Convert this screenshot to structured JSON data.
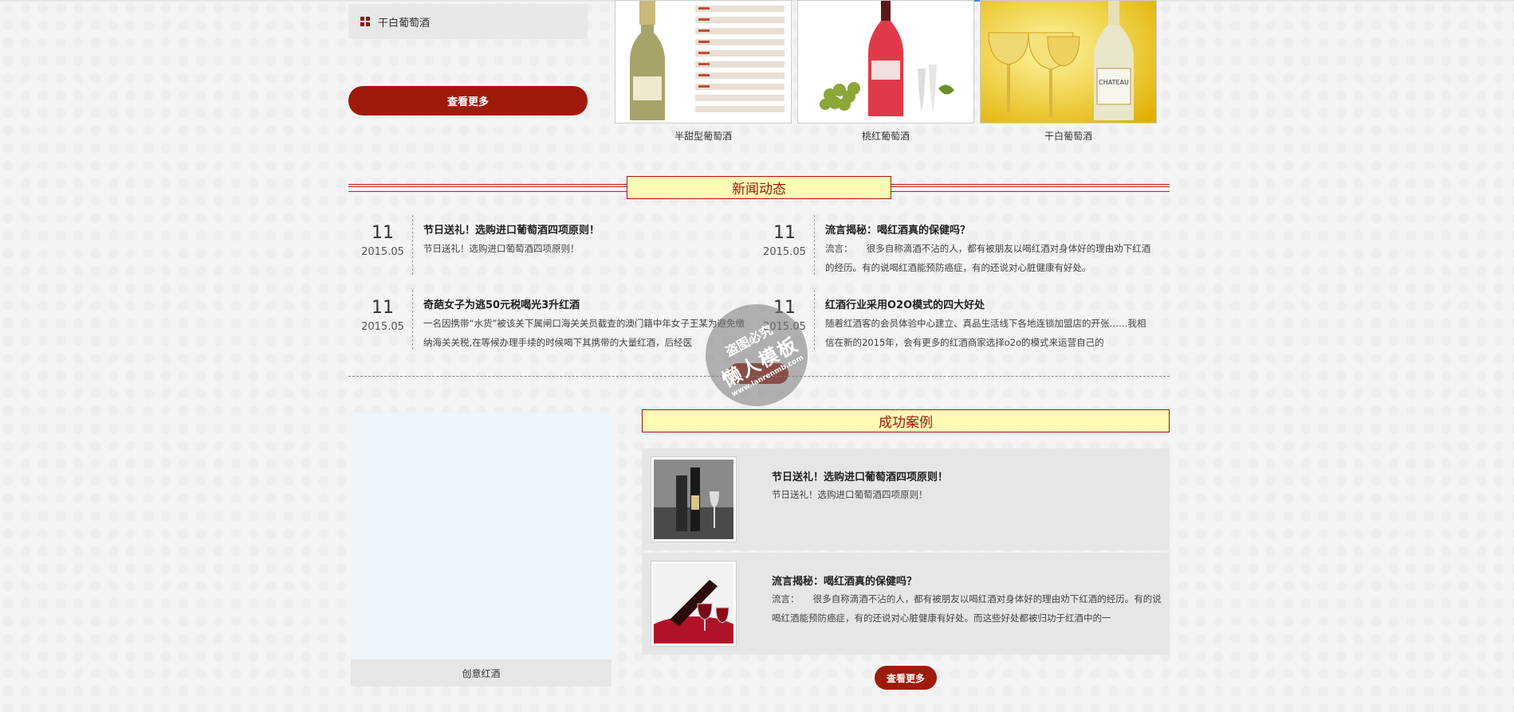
{
  "sidebar": {
    "category_label": "干白葡萄酒",
    "more_button": "查看更多"
  },
  "products": [
    {
      "caption": "半甜型葡萄酒"
    },
    {
      "caption": "桃红葡萄酒"
    },
    {
      "caption": "干白葡萄酒"
    }
  ],
  "news": {
    "title": "新闻动态",
    "items": [
      {
        "day": "11",
        "ym": "2015.05",
        "title": "节日送礼！选购进口葡萄酒四项原则！",
        "desc": "节日送礼！选购进口葡萄酒四项原则！"
      },
      {
        "day": "11",
        "ym": "2015.05",
        "title": "流言揭秘：喝红酒真的保健吗？",
        "desc": "流言：　　很多自称滴酒不沾的人，都有被朋友以喝红酒对身体好的理由劝下红酒的经历。有的说喝红酒能预防癌症，有的还说对心脏健康有好处。"
      },
      {
        "day": "11",
        "ym": "2015.05",
        "title": "奇葩女子为逃50元税喝光3升红酒",
        "desc": "一名因携带“水货”被该关下属闸口海关关员截查的澳门籍中年女子王某为避免缴纳海关关税,在等候办理手续的时候喝下其携带的大量红酒，后经医"
      },
      {
        "day": "11",
        "ym": "2015.05",
        "title": "红酒行业采用O2O模式的四大好处",
        "desc": "随着红酒客的会员体验中心建立、真品生活线下各地连锁加盟店的开张……我相信在新的2015年，会有更多的红酒商家选择o2o的模式来运营自己的"
      }
    ]
  },
  "watermark": {
    "line1": "盗图必究",
    "line2": "懒人模板",
    "line3": "www.lanrenmb.com"
  },
  "creative": {
    "caption": "创意红酒"
  },
  "cases": {
    "title": "成功案例",
    "items": [
      {
        "title": "节日送礼！选购进口葡萄酒四项原则！",
        "desc": "节日送礼！选购进口葡萄酒四项原则！"
      },
      {
        "title": "流言揭秘：喝红酒真的保健吗？",
        "desc": "流言：　　很多自称滴酒不沾的人，都有被朋友以喝红酒对身体好的理由劝下红酒的经历。有的说喝红酒能预防癌症，有的还说对心脏健康有好处。而这些好处都被归功于红酒中的一"
      }
    ],
    "more_button": "查看更多"
  }
}
